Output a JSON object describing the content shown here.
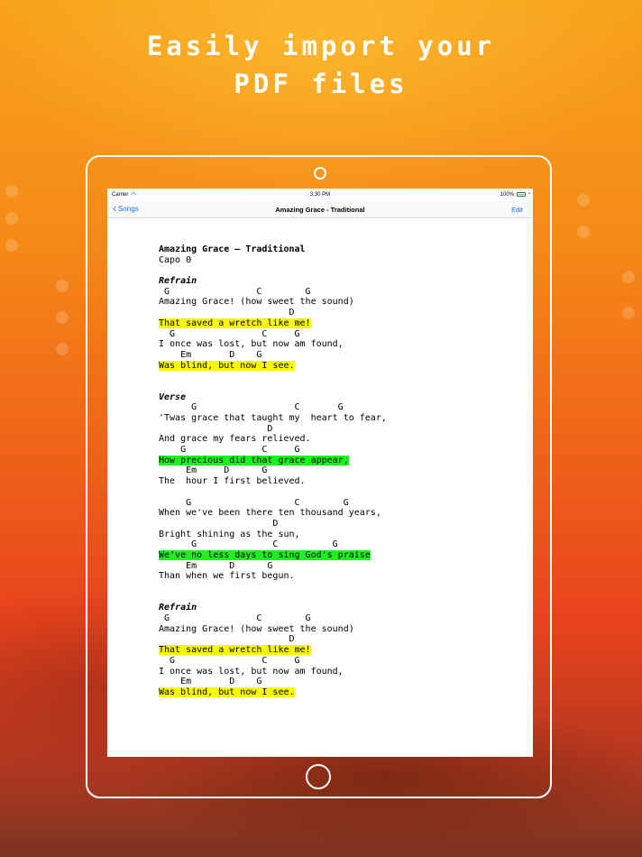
{
  "promo": {
    "headline": "Easily import your\nPDF files"
  },
  "device": {
    "status": {
      "carrier": "Carrier",
      "time": "3:30 PM",
      "battery": "100%"
    },
    "nav": {
      "back_label": "Songs",
      "title": "Amazing Grace - Traditional",
      "edit_label": "Edit"
    }
  },
  "song": {
    "lines": [
      {
        "text": "Amazing Grace – Traditional",
        "style": "title",
        "hl": ""
      },
      {
        "text": "Capo 0",
        "style": "",
        "hl": ""
      },
      {
        "text": "",
        "style": "",
        "hl": ""
      },
      {
        "text": "Refrain",
        "style": "section",
        "hl": ""
      },
      {
        "text": " G                C        G",
        "style": "",
        "hl": ""
      },
      {
        "text": "Amazing Grace! (how sweet the sound)",
        "style": "",
        "hl": ""
      },
      {
        "text": "                        D",
        "style": "",
        "hl": ""
      },
      {
        "text": "That saved a wretch like me!",
        "style": "",
        "hl": "yellow"
      },
      {
        "text": "  G                C     G",
        "style": "",
        "hl": ""
      },
      {
        "text": "I once was lost, but now am found,",
        "style": "",
        "hl": ""
      },
      {
        "text": "    Em       D    G",
        "style": "",
        "hl": ""
      },
      {
        "text": "Was blind, but now I see.",
        "style": "",
        "hl": "yellow"
      },
      {
        "text": "",
        "style": "",
        "hl": ""
      },
      {
        "text": "",
        "style": "",
        "hl": ""
      },
      {
        "text": "Verse",
        "style": "section",
        "hl": ""
      },
      {
        "text": "      G                  C       G",
        "style": "",
        "hl": ""
      },
      {
        "text": "'Twas grace that taught my  heart to fear,",
        "style": "",
        "hl": ""
      },
      {
        "text": "                    D",
        "style": "",
        "hl": ""
      },
      {
        "text": "And grace my fears relieved.",
        "style": "",
        "hl": ""
      },
      {
        "text": "    G              C     G",
        "style": "",
        "hl": ""
      },
      {
        "text": "How precious did that grace appear,",
        "style": "",
        "hl": "green"
      },
      {
        "text": "     Em     D      G",
        "style": "",
        "hl": ""
      },
      {
        "text": "The  hour I first believed.",
        "style": "",
        "hl": ""
      },
      {
        "text": "",
        "style": "",
        "hl": ""
      },
      {
        "text": "     G                   C        G",
        "style": "",
        "hl": ""
      },
      {
        "text": "When we've been there ten thousand years,",
        "style": "",
        "hl": ""
      },
      {
        "text": "                     D",
        "style": "",
        "hl": ""
      },
      {
        "text": "Bright shining as the sun,",
        "style": "",
        "hl": ""
      },
      {
        "text": "      G              C          G",
        "style": "",
        "hl": ""
      },
      {
        "text": "We've no less days to sing God's praise",
        "style": "",
        "hl": "green"
      },
      {
        "text": "     Em      D      G",
        "style": "",
        "hl": ""
      },
      {
        "text": "Than when we first begun.",
        "style": "",
        "hl": ""
      },
      {
        "text": "",
        "style": "",
        "hl": ""
      },
      {
        "text": "",
        "style": "",
        "hl": ""
      },
      {
        "text": "Refrain",
        "style": "section",
        "hl": ""
      },
      {
        "text": " G                C        G",
        "style": "",
        "hl": ""
      },
      {
        "text": "Amazing Grace! (how sweet the sound)",
        "style": "",
        "hl": ""
      },
      {
        "text": "                        D",
        "style": "",
        "hl": ""
      },
      {
        "text": "That saved a wretch like me!",
        "style": "",
        "hl": "yellow"
      },
      {
        "text": "  G                C     G",
        "style": "",
        "hl": ""
      },
      {
        "text": "I once was lost, but now am found,",
        "style": "",
        "hl": ""
      },
      {
        "text": "    Em       D    G",
        "style": "",
        "hl": ""
      },
      {
        "text": "Was blind, but now I see.",
        "style": "",
        "hl": "yellow"
      }
    ]
  },
  "colors": {
    "highlight_yellow": "#f8f800",
    "highlight_green": "#17f51d",
    "link_blue": "#1a73e8"
  }
}
